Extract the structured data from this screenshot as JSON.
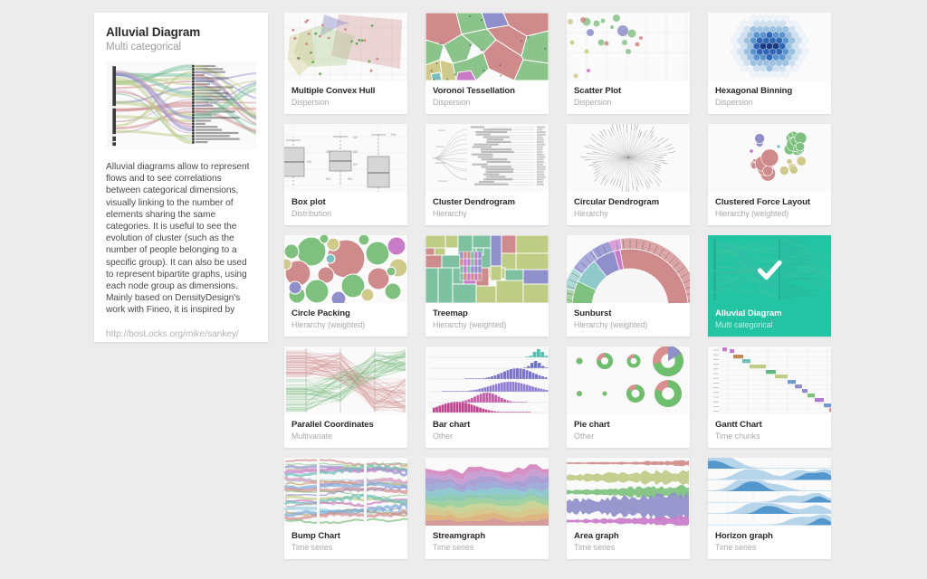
{
  "detail": {
    "title": "Alluvial Diagram",
    "subtitle": "Multi categorical",
    "thumbnail_name": "alluvial-diagram-preview",
    "description": "Alluvial diagrams allow to represent flows and to see correlations between categorical dimensions, visually linking to the number of elements sharing the same categories. It is useful to see the evolution of cluster (such as the number of people belonging to a specific group). It can also be used to represent bipartite graphs, using each node group as dimensions.\nMainly based on DensityDesign's work with Fineo, it is inspired by",
    "link": "http://bost.ocks.org/mike/sankey/"
  },
  "theme": {
    "page_background": "#ececec",
    "card_background": "#ffffff",
    "thumb_background": "#fafafa",
    "selected_accent": "#22c4a4",
    "title_color": "#2b2b2b",
    "subtitle_color": "#a8a8a8"
  },
  "cards": [
    {
      "title": "Multiple Convex Hull",
      "category": "Dispersion",
      "thumb": "convex-hull",
      "selected": false
    },
    {
      "title": "Voronoi Tessellation",
      "category": "Dispersion",
      "thumb": "voronoi",
      "selected": false
    },
    {
      "title": "Scatter Plot",
      "category": "Dispersion",
      "thumb": "scatter",
      "selected": false
    },
    {
      "title": "Hexagonal Binning",
      "category": "Dispersion",
      "thumb": "hexbin",
      "selected": false
    },
    {
      "title": "Box plot",
      "category": "Distribution",
      "thumb": "boxplot",
      "selected": false
    },
    {
      "title": "Cluster Dendrogram",
      "category": "Hierarchy",
      "thumb": "cluster-dendrogram",
      "selected": false
    },
    {
      "title": "Circular Dendrogram",
      "category": "Hierarchy",
      "thumb": "circular-dendrogram",
      "selected": false
    },
    {
      "title": "Clustered Force Layout",
      "category": "Hierarchy (weighted)",
      "thumb": "force-layout",
      "selected": false
    },
    {
      "title": "Circle Packing",
      "category": "Hierarchy (weighted)",
      "thumb": "circle-packing",
      "selected": false
    },
    {
      "title": "Treemap",
      "category": "Hierarchy (weighted)",
      "thumb": "treemap",
      "selected": false
    },
    {
      "title": "Sunburst",
      "category": "Hierarchy (weighted)",
      "thumb": "sunburst",
      "selected": false
    },
    {
      "title": "Alluvial Diagram",
      "category": "Multi categorical",
      "thumb": "alluvial",
      "selected": true
    },
    {
      "title": "Parallel Coordinates",
      "category": "Multivariate",
      "thumb": "parallel-coordinates",
      "selected": false
    },
    {
      "title": "Bar chart",
      "category": "Other",
      "thumb": "barchart",
      "selected": false
    },
    {
      "title": "Pie chart",
      "category": "Other",
      "thumb": "piechart",
      "selected": false
    },
    {
      "title": "Gantt Chart",
      "category": "Time chunks",
      "thumb": "gantt",
      "selected": false
    },
    {
      "title": "Bump Chart",
      "category": "Time series",
      "thumb": "bump",
      "selected": false
    },
    {
      "title": "Streamgraph",
      "category": "Time series",
      "thumb": "streamgraph",
      "selected": false
    },
    {
      "title": "Area graph",
      "category": "Time series",
      "thumb": "area",
      "selected": false
    },
    {
      "title": "Horizon graph",
      "category": "Time series",
      "thumb": "horizon",
      "selected": false
    }
  ],
  "selected_check_icon": "check-icon"
}
